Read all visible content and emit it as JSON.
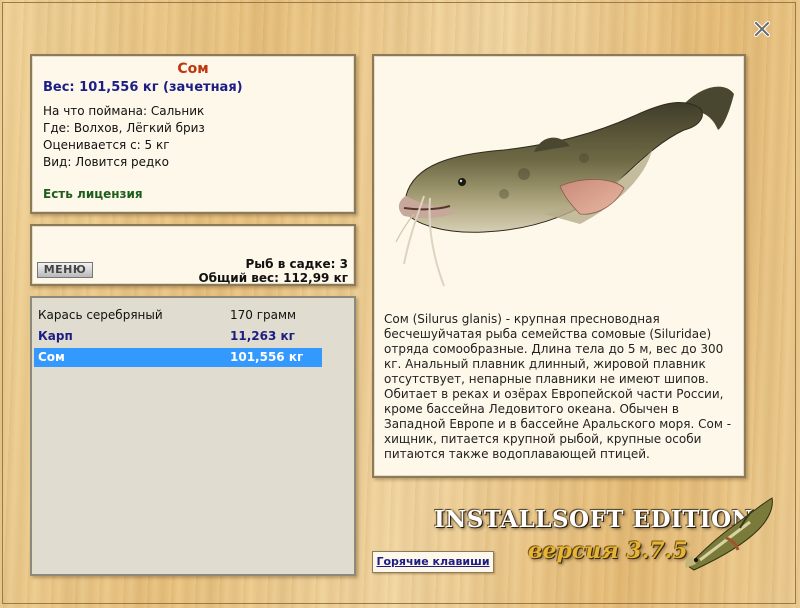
{
  "window": {
    "close_label": "close"
  },
  "fish": {
    "name": "Сом",
    "weight_line": "Вес: 101,556 кг (зачетная)",
    "caught_with": "На что поймана: Сальник",
    "location": "Где: Волхов, Лёгкий бриз",
    "valuation": "Оценивается с: 5 кг",
    "kind": "Вид: Ловится редко",
    "license": "Есть лицензия",
    "description": "Сом (Silurus glanis) - крупная пресноводная бесчешуйчатая рыба семейства сомовые (Siluridae) отряда сомообразные. Длина тела до 5 м, вес до 300 кг. Анальный плавник длинный, жировой плавник отсутствует, непарные плавники не имеют шипов. Обитает в реках и озёрах Европейской части России, кроме бассейна Ледовитого океана. Обычен в Западной Европе и в бассейне Аральского моря. Сом - хищник, питается крупной рыбой, крупные особи питаются также водоплавающей птицей."
  },
  "cage": {
    "menu_label": "МЕНЮ",
    "count_line": "Рыб в садке: 3",
    "total_line": "Общий вес: 112,99 кг"
  },
  "catch_list": [
    {
      "name": "Карась серебряный",
      "weight": "170 грамм",
      "style": "normal"
    },
    {
      "name": "Карп",
      "weight": "11,263 кг",
      "style": "bold"
    },
    {
      "name": "Сом",
      "weight": "101,556 кг",
      "style": "selected"
    }
  ],
  "branding": {
    "edition": "INSTALLSOFT EDITION",
    "version": "версия 3.7.5"
  },
  "footer": {
    "hotkeys_label": "Горячие клавиши"
  },
  "colors": {
    "title": "#c0360e",
    "weight": "#1c1e86",
    "license": "#1d5e1d",
    "selection": "#3399ff"
  }
}
